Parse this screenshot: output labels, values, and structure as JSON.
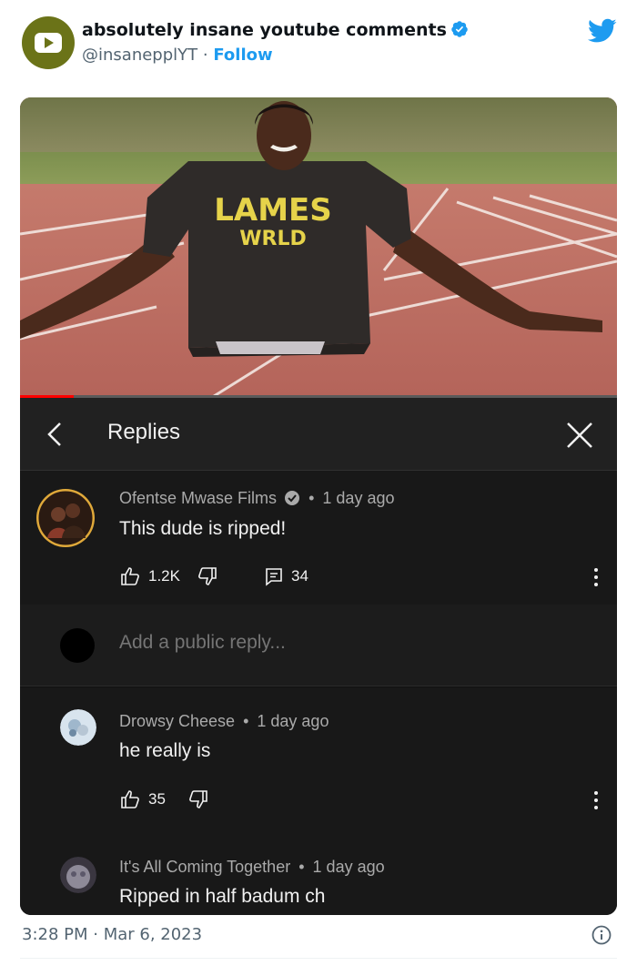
{
  "tweet": {
    "display_name": "absolutely insane youtube comments",
    "handle": "@insanepplYT",
    "separator": "·",
    "follow_label": "Follow",
    "timestamp": "3:28 PM · Mar 6, 2023",
    "colors": {
      "twitter_blue": "#1d9bf0",
      "avatar_bg": "#6b7318"
    },
    "icons": [
      "youtube-logo-icon",
      "verified-badge-icon",
      "twitter-bird-icon",
      "info-icon"
    ]
  },
  "video": {
    "shirt_text_line1": "LAMES",
    "shirt_text_line2": "WRLD",
    "progress": 0.09,
    "progress_color": "#ff0000"
  },
  "replies_panel": {
    "title": "Replies",
    "icons": [
      "back-chevron-icon",
      "close-icon"
    ],
    "parent_comment": {
      "author": "Ofentse Mwase Films",
      "time": "1 day ago",
      "text": "This dude is ripped!",
      "likes": "1.2K",
      "reply_count": "34"
    },
    "reply_placeholder": "Add a public reply...",
    "replies": [
      {
        "author": "Drowsy Cheese",
        "time": "1 day ago",
        "text": "he really is",
        "likes": "35"
      },
      {
        "author": "It's All Coming Together",
        "time": "1 day ago",
        "text": "Ripped in half badum ch"
      }
    ],
    "bullet": "•"
  }
}
